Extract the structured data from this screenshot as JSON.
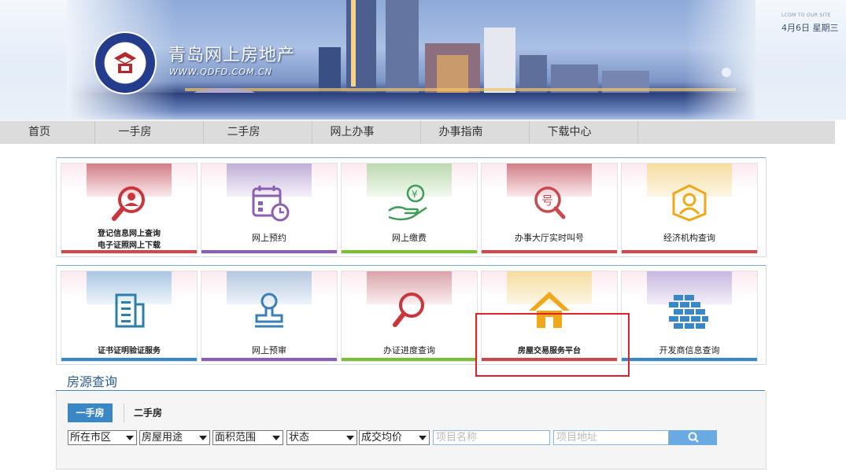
{
  "header": {
    "site_title": "青岛网上房地产",
    "site_url": "WWW.QDFD.COM.CN",
    "welcome": "LCOM TO OUR SITE",
    "date": "4月6日 星期三"
  },
  "nav": {
    "items": [
      {
        "label": "首页"
      },
      {
        "label": "一手房"
      },
      {
        "label": "二手房"
      },
      {
        "label": "网上办事"
      },
      {
        "label": "办事指南"
      },
      {
        "label": "下载中心"
      }
    ]
  },
  "tiles_row1": [
    {
      "line1": "登记信息网上查询",
      "line2": "电子证照网上下载",
      "icon": "person-search-icon",
      "accent": "#c94b50"
    },
    {
      "line1": "网上预约",
      "icon": "calendar-clock-icon",
      "accent": "#8b5fb1"
    },
    {
      "line1": "网上缴费",
      "icon": "hand-coin-icon",
      "accent": "#7cbf35"
    },
    {
      "line1": "办事大厅实时叫号",
      "icon": "number-search-icon",
      "accent": "#c94b50"
    },
    {
      "line1": "经济机构查询",
      "icon": "person-badge-icon",
      "accent": "#f0a818"
    }
  ],
  "tiles_row2": [
    {
      "line1": "证书证明验证服务",
      "icon": "building-icon",
      "accent": "#3a87c6"
    },
    {
      "line1": "网上预审",
      "icon": "stamp-icon",
      "accent": "#8b5fb1"
    },
    {
      "line1": "办证进度查询",
      "icon": "magnifier-icon",
      "accent": "#7cbf35"
    },
    {
      "line1": "房屋交易服务平台",
      "icon": "house-icon",
      "accent": "#c94b50"
    },
    {
      "line1": "开发商信息查询",
      "icon": "brick-wall-icon",
      "accent": "#3a87c6"
    }
  ],
  "search": {
    "title": "房源查询",
    "tab_active": "一手房",
    "tab_other": "二手房",
    "selects": [
      "所在市区",
      "房屋用途",
      "面积范围",
      "状态",
      "成交均价"
    ],
    "project_name_placeholder": "项目名称",
    "project_address_placeholder": "项目地址"
  }
}
